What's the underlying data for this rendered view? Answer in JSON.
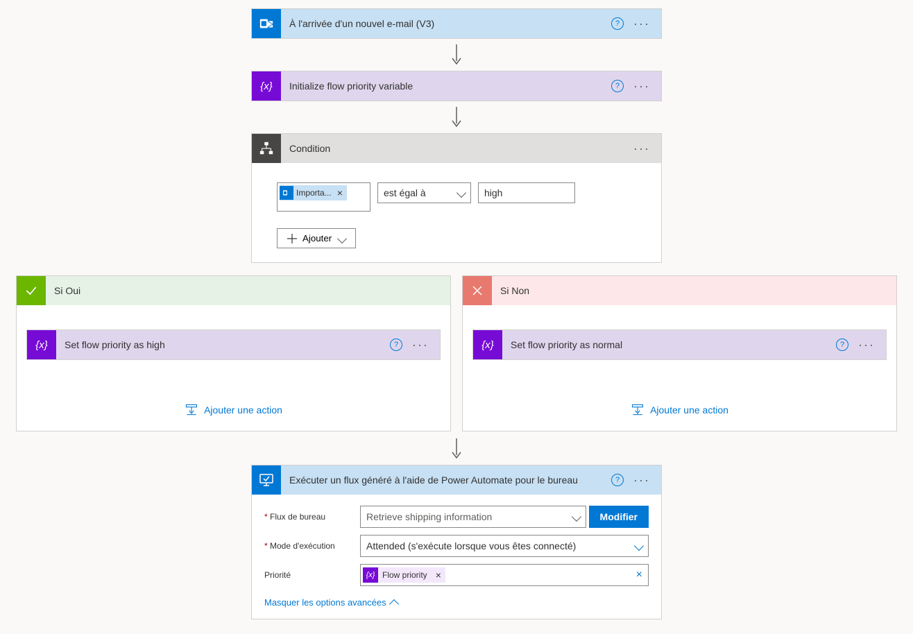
{
  "trigger": {
    "title": "À l'arrivée d'un nouvel e-mail (V3)"
  },
  "init_var": {
    "title": "Initialize flow priority variable"
  },
  "condition": {
    "title": "Condition",
    "token_label": "Importa...",
    "operator": "est égal à",
    "value": "high",
    "add_label": "Ajouter"
  },
  "branches": {
    "yes": {
      "label": "Si Oui",
      "action_title": "Set flow priority as high",
      "add_action": "Ajouter une action"
    },
    "no": {
      "label": "Si Non",
      "action_title": "Set flow priority as normal",
      "add_action": "Ajouter une action"
    }
  },
  "desktop": {
    "title": "Exécuter un flux généré à l'aide de Power Automate pour le bureau",
    "field_flow_label": "Flux de bureau",
    "field_flow_value": "Retrieve shipping information",
    "modifier": "Modifier",
    "field_mode_label": "Mode d'exécution",
    "field_mode_value": "Attended (s'exécute lorsque vous êtes connecté)",
    "field_priority_label": "Priorité",
    "priority_chip": "Flow priority",
    "hide_options": "Masquer les options avancées"
  }
}
